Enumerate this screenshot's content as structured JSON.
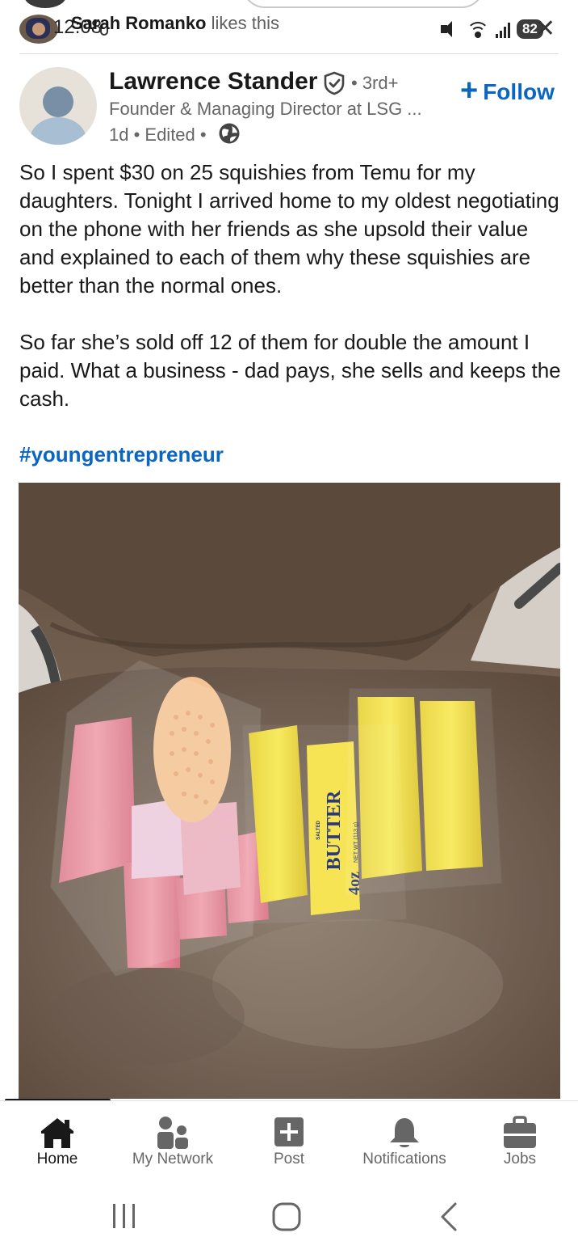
{
  "status_bar": {
    "time": "12:08",
    "battery": "82"
  },
  "social_context": {
    "name": "Sarah Romanko",
    "action": " likes this"
  },
  "post": {
    "author": {
      "name": "Lawrence Stander",
      "degree": "• 3rd+",
      "headline": "Founder & Managing Director at LSG ...",
      "meta": "1d • Edited •"
    },
    "follow_label": "Follow",
    "paragraphs": [
      "So I spent $30 on 25 squishies from Temu for my daughters. Tonight I arrived home to my oldest negotiating on the phone with her friends as she upsold their value and explained to each of them why these squishies are better than the normal ones.",
      "So far she’s sold off 12 of them for double the amount I paid. What a business - dad pays, she sells and keeps the cash."
    ],
    "hashtag": "#youngentrepreneur",
    "image": {
      "butter_stamp_salted": "SALTED",
      "butter_stamp_main": "BUTTER",
      "butter_stamp_weight": "4oz",
      "butter_stamp_net": "NET WT (113 g)"
    }
  },
  "bottom_nav": {
    "items": [
      {
        "label": "Home",
        "icon": "home-icon",
        "active": true
      },
      {
        "label": "My Network",
        "icon": "network-icon",
        "active": false
      },
      {
        "label": "Post",
        "icon": "post-icon",
        "active": false
      },
      {
        "label": "Notifications",
        "icon": "bell-icon",
        "active": false
      },
      {
        "label": "Jobs",
        "icon": "briefcase-icon",
        "active": false
      }
    ]
  },
  "colors": {
    "accent": "#0a66c2",
    "text": "#191919",
    "muted": "#666666"
  }
}
